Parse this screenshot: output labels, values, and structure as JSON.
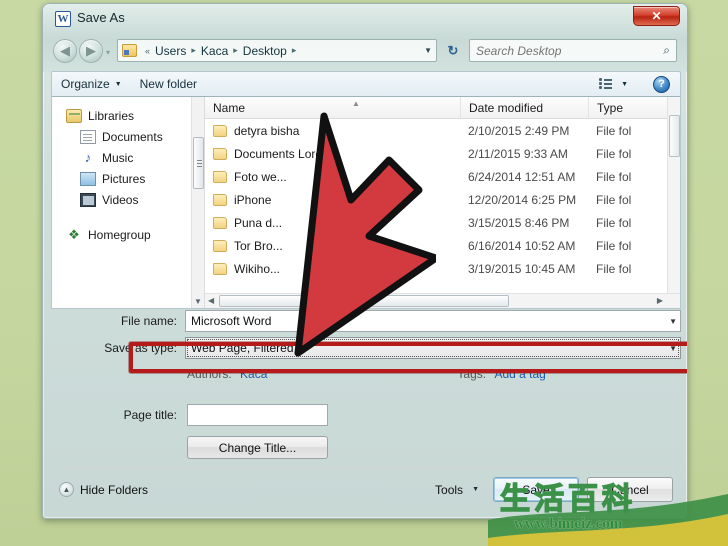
{
  "window": {
    "title": "Save As",
    "app_icon": "word-icon",
    "close_label": "✕"
  },
  "nav": {
    "back_icon": "◀",
    "forward_icon": "▶",
    "recent_icon": "▾",
    "breadcrumb": [
      "Users",
      "Kaca",
      "Desktop"
    ],
    "breadcrumb_prefix": "«",
    "breadcrumb_sep": "▸",
    "dropdown_icon": "▼",
    "refresh_icon": "↻"
  },
  "search": {
    "placeholder": "Search Desktop",
    "icon": "⌕"
  },
  "toolbar": {
    "organize_label": "Organize",
    "organize_caret": "▼",
    "new_folder_label": "New folder",
    "view_caret": "▼",
    "help_label": "?"
  },
  "sidebar": {
    "items": [
      {
        "label": "Libraries",
        "icon": "library-icon",
        "indent": false
      },
      {
        "label": "Documents",
        "icon": "document-icon",
        "indent": true
      },
      {
        "label": "Music",
        "icon": "music-icon",
        "indent": true,
        "glyph": "♪"
      },
      {
        "label": "Pictures",
        "icon": "picture-icon",
        "indent": true
      },
      {
        "label": "Videos",
        "icon": "video-icon",
        "indent": true
      },
      {
        "label": "Homegroup",
        "icon": "homegroup-icon",
        "indent": false,
        "glyph": "❖"
      }
    ],
    "scroll_down_icon": "▼"
  },
  "filelist": {
    "columns": [
      "Name",
      "Date modified",
      "Type"
    ],
    "sort_icon": "▲",
    "rows": [
      {
        "name": "detyra bisha",
        "date": "2/10/2015 2:49 PM",
        "type": "File fol"
      },
      {
        "name": "Documents Loren",
        "date": "2/11/2015 9:33 AM",
        "type": "File fol"
      },
      {
        "name": "Foto we...",
        "date": "6/24/2014 12:51 AM",
        "type": "File fol"
      },
      {
        "name": "iPhone",
        "date": "12/20/2014 6:25 PM",
        "type": "File fol"
      },
      {
        "name": "Puna d...",
        "date": "3/15/2015 8:46 PM",
        "type": "File fol"
      },
      {
        "name": "Tor Bro...",
        "date": "6/16/2014 10:52 AM",
        "type": "File fol"
      },
      {
        "name": "Wikiho...",
        "date": "3/19/2015 10:45 AM",
        "type": "File fol"
      }
    ],
    "hscroll_left_icon": "◀",
    "hscroll_right_icon": "▶"
  },
  "form": {
    "file_name_label": "File name:",
    "file_name_value": "Microsoft Word",
    "save_as_type_label": "Save as type:",
    "save_as_type_value": "Web Page, Filtered",
    "dropdown_icon": "▼",
    "authors_label": "Authors:",
    "authors_value": "Kaca",
    "tags_label": "Tags:",
    "tags_value": "Add a tag",
    "page_title_label": "Page title:",
    "page_title_value": "",
    "change_title_label": "Change Title..."
  },
  "footer": {
    "hide_folders_label": "Hide Folders",
    "hide_folders_icon": "▲",
    "tools_label": "Tools",
    "tools_caret": "▼",
    "save_label": "Save",
    "cancel_label": "Cancel"
  },
  "annotation": {
    "arrow_color": "#d33a3f",
    "arrow_outline": "#111111",
    "highlight_color": "#b51b1b",
    "target": "save-as-type-combobox"
  },
  "watermark": {
    "url": "www.bimeiz.com",
    "cn_text": "生活百科",
    "color": "#2f8a3c"
  },
  "colors": {
    "desktop_background": "#c5d79e",
    "window_chrome": "#cfdedb",
    "accent_blue": "#1a5dab"
  }
}
